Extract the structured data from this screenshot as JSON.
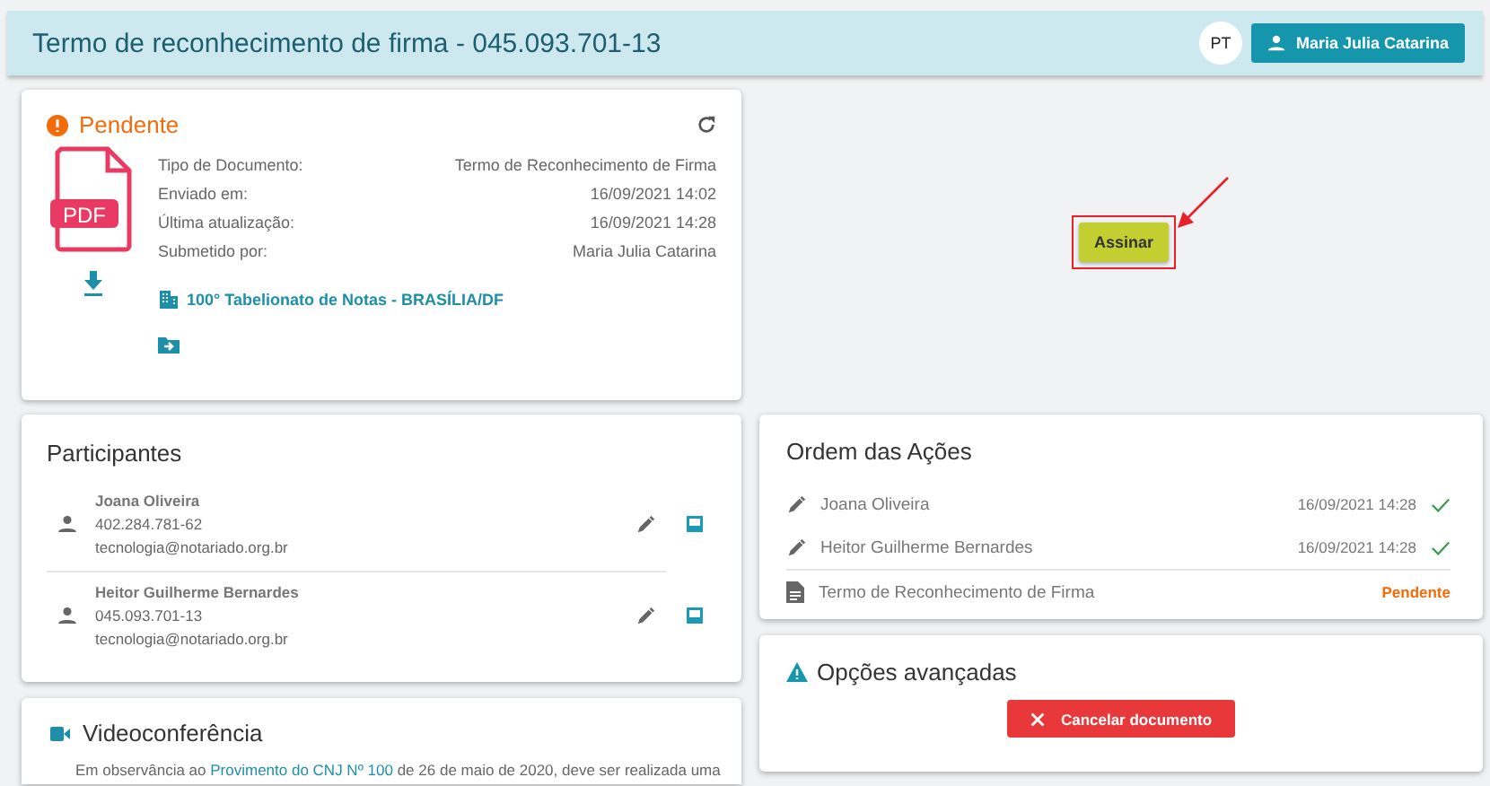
{
  "header": {
    "title": "Termo de reconhecimento de firma - 045.093.701-13",
    "language": "PT",
    "user_button": "Maria Julia Catarina"
  },
  "document": {
    "status": "Pendente",
    "file_type": "PDF",
    "fields": [
      {
        "label": "Tipo de Documento:",
        "value": "Termo de Reconhecimento de Firma"
      },
      {
        "label": "Enviado em:",
        "value": "16/09/2021 14:02"
      },
      {
        "label": "Última atualização:",
        "value": "16/09/2021 14:28"
      },
      {
        "label": "Submetido por:",
        "value": "Maria Julia Catarina"
      }
    ],
    "office": "100° Tabelionato de Notas - BRASÍLIA/DF"
  },
  "sign_button": "Assinar",
  "participants": {
    "title": "Participantes",
    "items": [
      {
        "name": "Joana Oliveira",
        "document": "402.284.781-62",
        "email": "tecnologia@notariado.org.br"
      },
      {
        "name": "Heitor Guilherme Bernardes",
        "document": "045.093.701-13",
        "email": "tecnologia@notariado.org.br"
      }
    ]
  },
  "video": {
    "title": "Videoconferência",
    "text_before": "Em observância ao ",
    "link": "Provimento do CNJ Nº 100",
    "text_after": " de 26 de maio de 2020, deve ser realizada uma"
  },
  "actions": {
    "title": "Ordem das Ações",
    "items": [
      {
        "kind": "signature",
        "name": "Joana Oliveira",
        "time": "16/09/2021 14:28",
        "done": true
      },
      {
        "kind": "signature",
        "name": "Heitor Guilherme Bernardes",
        "time": "16/09/2021 14:28",
        "done": true
      },
      {
        "kind": "document",
        "name": "Termo de Reconhecimento de Firma",
        "status": "Pendente"
      }
    ]
  },
  "advanced": {
    "title": "Opções avançadas",
    "button": "Cancelar documento"
  }
}
